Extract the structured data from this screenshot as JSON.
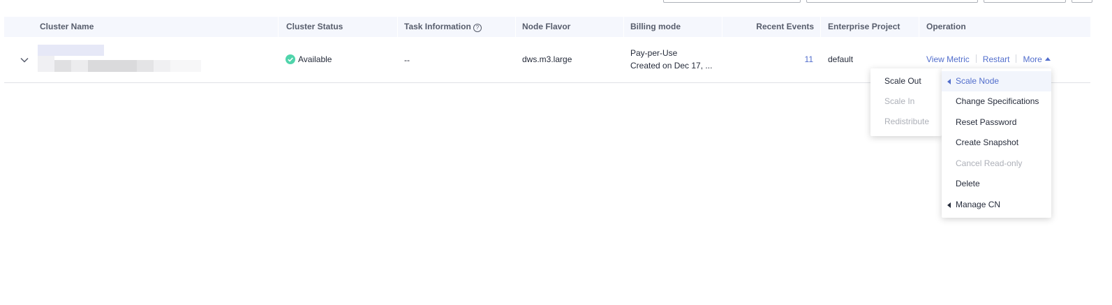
{
  "table": {
    "headers": {
      "cluster_name": "Cluster Name",
      "cluster_status": "Cluster Status",
      "task_information": "Task Information",
      "node_flavor": "Node Flavor",
      "billing_mode": "Billing mode",
      "recent_events": "Recent Events",
      "enterprise_project": "Enterprise Project",
      "operation": "Operation"
    },
    "rows": [
      {
        "cluster_status": "Available",
        "task_information": "--",
        "node_flavor": "dws.m3.large",
        "billing_mode_line1": "Pay-per-Use",
        "billing_mode_line2": "Created on Dec 17, ...",
        "recent_events": "11",
        "enterprise_project": "default",
        "operations": {
          "view_metric": "View Metric",
          "restart": "Restart",
          "more": "More"
        }
      }
    ]
  },
  "more_menu": {
    "items": [
      {
        "label": "Scale Node",
        "has_submenu": true,
        "active": true,
        "disabled": false
      },
      {
        "label": "Change Specifications",
        "has_submenu": false,
        "active": false,
        "disabled": false
      },
      {
        "label": "Reset Password",
        "has_submenu": false,
        "active": false,
        "disabled": false
      },
      {
        "label": "Create Snapshot",
        "has_submenu": false,
        "active": false,
        "disabled": false
      },
      {
        "label": "Cancel Read-only",
        "has_submenu": false,
        "active": false,
        "disabled": true
      },
      {
        "label": "Delete",
        "has_submenu": false,
        "active": false,
        "disabled": false
      },
      {
        "label": "Manage CN",
        "has_submenu": true,
        "active": false,
        "disabled": false
      }
    ]
  },
  "scale_submenu": {
    "items": [
      {
        "label": "Scale Out",
        "disabled": false
      },
      {
        "label": "Scale In",
        "disabled": true
      },
      {
        "label": "Redistribute",
        "disabled": true
      }
    ]
  },
  "colors": {
    "link": "#526ecc",
    "status_available": "#50d4ab",
    "header_bg": "#f5f7fd",
    "disabled_text": "#adb0b8"
  },
  "icons": {
    "expander": "chevron-down-icon",
    "status": "check-circle-icon",
    "help": "help-circle-icon",
    "more_caret": "caret-up-icon",
    "submenu_caret": "caret-left-icon"
  }
}
